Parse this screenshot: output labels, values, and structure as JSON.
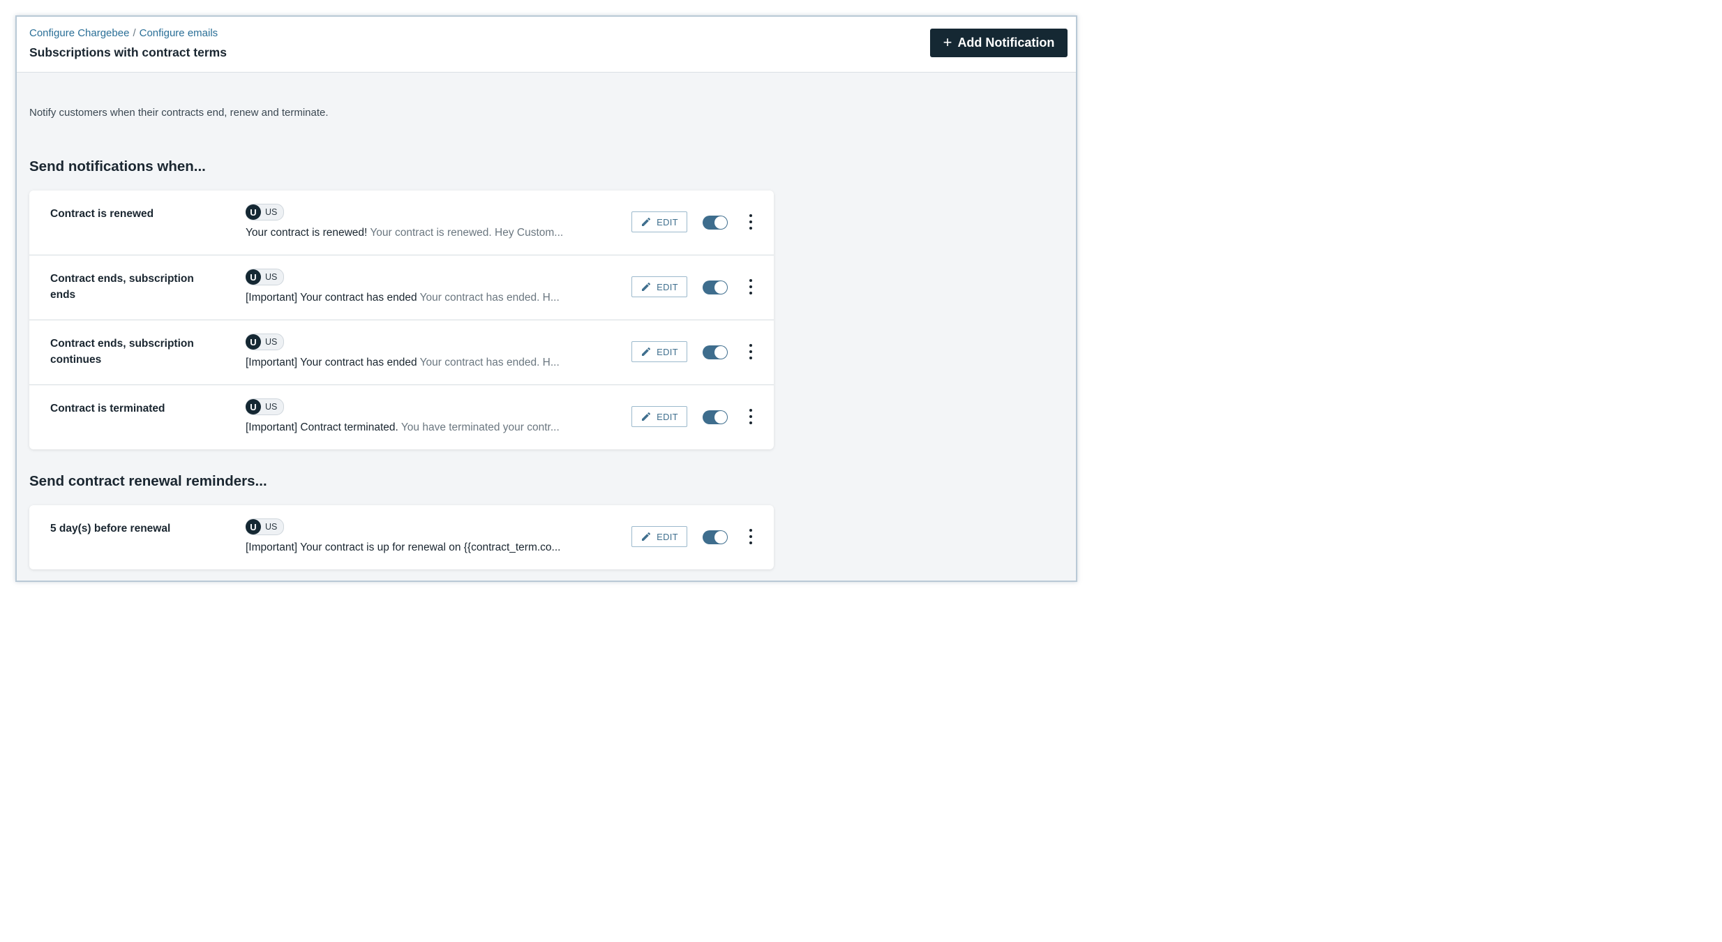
{
  "breadcrumb": {
    "items": [
      "Configure Chargebee",
      "Configure emails"
    ],
    "separator": "/"
  },
  "header": {
    "title": "Subscriptions with contract terms",
    "add_button_label": "Add Notification",
    "add_button_icon": "plus-icon"
  },
  "description": "Notify customers when their contracts end, renew and terminate.",
  "sections": [
    {
      "heading": "Send notifications when...",
      "rows": [
        {
          "name": "Contract is renewed",
          "lang_initial": "U",
          "lang_code": "US",
          "subject": "Your contract is renewed!",
          "preview": "Your contract is renewed. Hey Custom...",
          "edit_label": "EDIT",
          "enabled": true
        },
        {
          "name": "Contract ends, subscription ends",
          "lang_initial": "U",
          "lang_code": "US",
          "subject": "[Important] Your contract has ended",
          "preview": "Your contract has ended. H...",
          "edit_label": "EDIT",
          "enabled": true
        },
        {
          "name": "Contract ends, subscription continues",
          "lang_initial": "U",
          "lang_code": "US",
          "subject": "[Important] Your contract has ended",
          "preview": "Your contract has ended. H...",
          "edit_label": "EDIT",
          "enabled": true
        },
        {
          "name": "Contract is terminated",
          "lang_initial": "U",
          "lang_code": "US",
          "subject": "[Important] Contract terminated.",
          "preview": "You have terminated your contr...",
          "edit_label": "EDIT",
          "enabled": true
        }
      ]
    },
    {
      "heading": "Send contract renewal reminders...",
      "rows": [
        {
          "name": "5 day(s) before renewal",
          "lang_initial": "U",
          "lang_code": "US",
          "subject": "[Important] Your contract is up for renewal on {{contract_term.co...",
          "preview": "",
          "edit_label": "EDIT",
          "enabled": true
        }
      ]
    }
  ],
  "colors": {
    "primary_dark": "#152833",
    "accent": "#3e6d8d",
    "link": "#2a6f97"
  }
}
